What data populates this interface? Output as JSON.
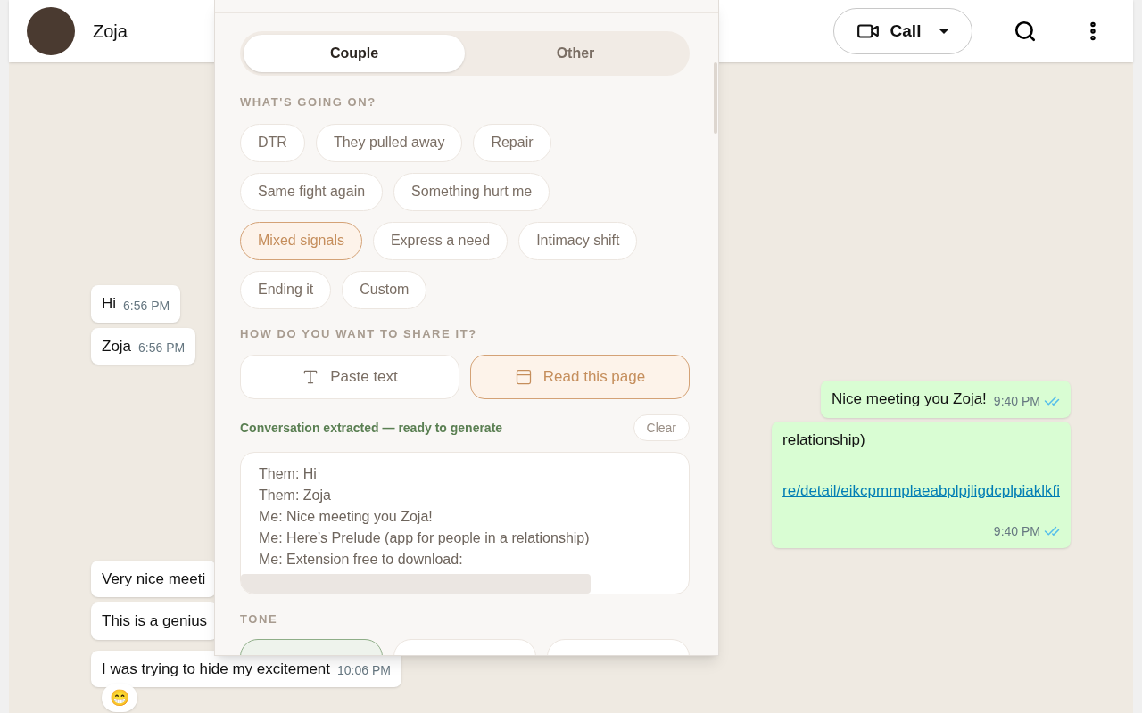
{
  "chat_header": {
    "contact_name": "Zoja",
    "call_button": "Call"
  },
  "messages": [
    {
      "kind": "incoming",
      "text": "Hi",
      "time": "6:56 PM"
    },
    {
      "kind": "incoming",
      "text": "Zoja",
      "time": "6:56 PM"
    },
    {
      "kind": "outgoing",
      "text": "Nice meeting you Zoja!",
      "time": "9:40 PM",
      "read": true
    },
    {
      "kind": "outgoing",
      "text": "relationship)",
      "link": "re/detail/eikcpmmplaeabplpjligdcplpiaklkfi",
      "time": "9:40 PM",
      "read": true
    },
    {
      "kind": "incoming",
      "text": "Very nice meeti"
    },
    {
      "kind": "incoming",
      "text": "This is a genius"
    },
    {
      "kind": "incoming",
      "text": "I was trying to hide my excitement",
      "time": "10:06 PM",
      "reaction": "😁"
    }
  ],
  "popup": {
    "segments": [
      {
        "label": "Couple",
        "selected": true
      },
      {
        "label": "Other",
        "selected": false
      }
    ],
    "situation_label": "WHAT'S GOING ON?",
    "situation_rows": [
      [
        {
          "label": "DTR",
          "selected": false
        },
        {
          "label": "They pulled away",
          "selected": false
        },
        {
          "label": "Repair",
          "selected": false
        }
      ],
      [
        {
          "label": "Same fight again",
          "selected": false
        },
        {
          "label": "Something hurt me",
          "selected": false
        }
      ],
      [
        {
          "label": "Mixed signals",
          "selected": true
        },
        {
          "label": "Express a need",
          "selected": false
        },
        {
          "label": "Intimacy shift",
          "selected": false
        }
      ],
      [
        {
          "label": "Ending it",
          "selected": false
        },
        {
          "label": "Custom",
          "selected": false
        }
      ]
    ],
    "share_label": "HOW DO YOU WANT TO SHARE IT?",
    "share_options": [
      {
        "kind": "text",
        "label": "Paste text",
        "selected": false
      },
      {
        "kind": "page",
        "label": "Read this page",
        "selected": true
      }
    ],
    "status": "Conversation extracted — ready to generate",
    "clear_button": "Clear",
    "extracted_lines": [
      "Them: Hi",
      "Them: Zoja",
      "Me: Nice meeting you Zoja!",
      "Me: Here’s Prelude (app for people in a relationship)",
      "Me: Extension free to download:"
    ],
    "tone_label": "TONE",
    "tone_options": [
      {
        "selected": true
      },
      {
        "selected": false
      },
      {
        "selected": false
      }
    ]
  }
}
